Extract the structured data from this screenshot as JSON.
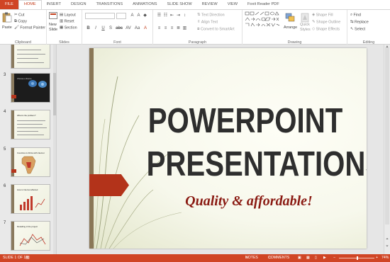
{
  "ribbon_tabs": [
    "FILE",
    "HOME",
    "INSERT",
    "DESIGN",
    "TRANSITIONS",
    "ANIMATIONS",
    "SLIDE SHOW",
    "REVIEW",
    "VIEW",
    "Foxit Reader PDF"
  ],
  "clipboard": {
    "paste": "Paste",
    "cut": "Cut",
    "copy": "Copy",
    "format_painter": "Format Painter",
    "label": "Clipboard"
  },
  "slides_group": {
    "new_slide_line1": "New",
    "new_slide_line2": "Slide",
    "layout": "Layout",
    "reset": "Reset",
    "section": "Section",
    "label": "Slides"
  },
  "font_group": {
    "label": "Font",
    "buttons": [
      "B",
      "I",
      "U",
      "S",
      "abc",
      "AV",
      "Aa",
      "A"
    ]
  },
  "paragraph_group": {
    "text_direction": "Text Direction",
    "align_text": "Align Text",
    "convert_smartart": "Convert to SmartArt",
    "label": "Paragraph"
  },
  "drawing_group": {
    "arrange": "Arrange",
    "quick_styles_1": "Quick",
    "quick_styles_2": "Styles",
    "shape_fill": "Shape Fill",
    "shape_outline": "Shape Outline",
    "shape_effects": "Shape Effects",
    "label": "Drawing"
  },
  "editing_group": {
    "find": "Find",
    "replace": "Replace",
    "select": "Select",
    "label": "Editing"
  },
  "thumbnails": [
    {
      "num": "",
      "title": ""
    },
    {
      "num": "3",
      "title": "Choose a theme"
    },
    {
      "num": "4",
      "title": "What is the problem?"
    },
    {
      "num": "5",
      "title": "Countries in Africa with internet"
    },
    {
      "num": "6",
      "title": "How is Internet affected"
    },
    {
      "num": "7",
      "title": "Modelling of the project"
    }
  ],
  "slide": {
    "title_line1": "POWERPOINT",
    "title_line2": "PRESENTATIONS",
    "subtitle": "Quality & affordable!"
  },
  "status": {
    "slide_counter": "SLIDE 1 OF 14",
    "notes": "NOTES",
    "comments": "COMMENTS",
    "zoom": "74%"
  },
  "colors": {
    "accent": "#d04525",
    "slide_red": "#b3331a",
    "subtitle": "#8a1a12"
  }
}
